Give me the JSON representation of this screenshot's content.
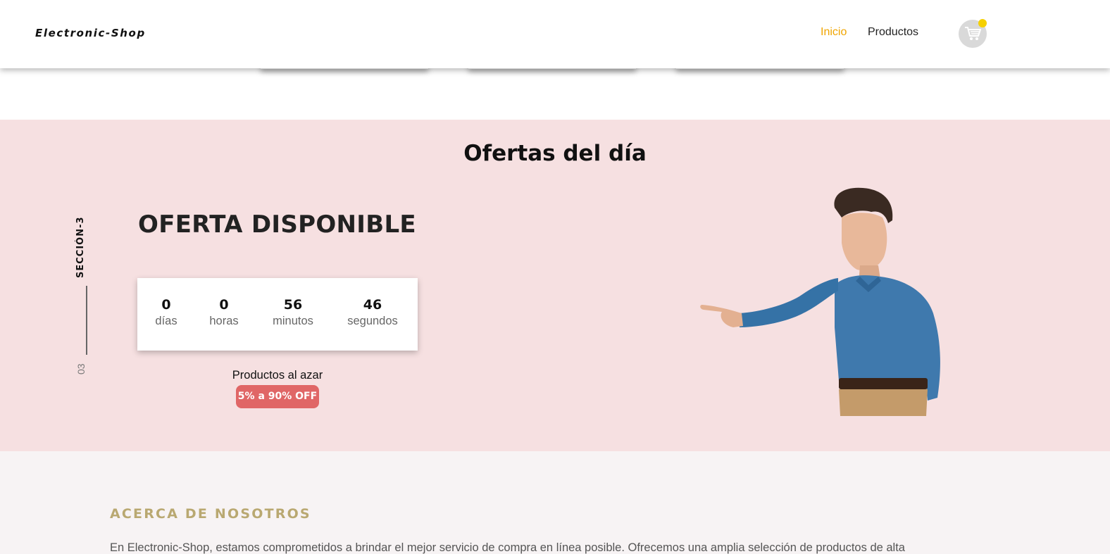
{
  "header": {
    "brand": "Electronic-Shop",
    "nav": [
      {
        "label": "Inicio",
        "active": true
      },
      {
        "label": "Productos",
        "active": false
      }
    ],
    "cart_icon": "shopping-cart-icon"
  },
  "colors": {
    "accent": "#f0a500",
    "offers_bg": "#f6e0e1",
    "badge": "#e06666",
    "cart_dot": "#f5d000",
    "about_title": "#b9a871",
    "about_bg": "#f7f3f4"
  },
  "offers": {
    "title": "Ofertas del día",
    "section_label": "SECCIÓN-3",
    "section_number": "03",
    "heading": "OFERTA DISPONIBLE",
    "countdown": [
      {
        "value": "0",
        "label": "días"
      },
      {
        "value": "0",
        "label": "horas"
      },
      {
        "value": "56",
        "label": "minutos"
      },
      {
        "value": "46",
        "label": "segundos"
      }
    ],
    "random_products": "Productos al azar",
    "discount": "5% a 90% OFF"
  },
  "about": {
    "title": "ACERCA DE NOSOTROS",
    "text": "En Electronic-Shop, estamos comprometidos a brindar el mejor servicio de compra en línea posible. Ofrecemos una amplia selección de productos de alta"
  }
}
